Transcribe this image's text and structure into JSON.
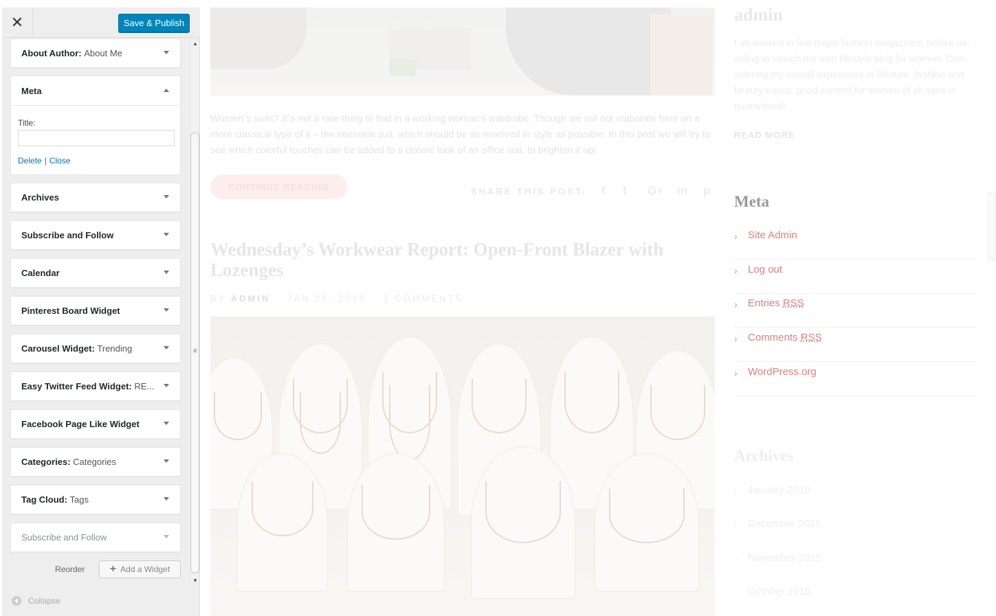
{
  "customizer": {
    "save_label": "Save & Publish",
    "close_glyph": "✕",
    "widgets_top": [
      {
        "title": "About Author",
        "sub": "About Me"
      }
    ],
    "meta_widget": {
      "title": "Meta",
      "title_label": "Title:",
      "title_value": "",
      "delete_label": "Delete",
      "separator": "|",
      "close_label": "Close"
    },
    "widgets": [
      {
        "title": "Archives",
        "sub": ""
      },
      {
        "title": "Subscribe and Follow",
        "sub": ""
      },
      {
        "title": "Calendar",
        "sub": ""
      },
      {
        "title": "Pinterest Board Widget",
        "sub": ""
      },
      {
        "title": "Carousel Widget",
        "sub": "Trending"
      },
      {
        "title": "Easy Twitter Feed Widget",
        "sub": "RE..."
      },
      {
        "title": "Facebook Page Like Widget",
        "sub": ""
      },
      {
        "title": "Categories",
        "sub": "Categories"
      },
      {
        "title": "Tag Cloud",
        "sub": "Tags"
      },
      {
        "title": "Subscribe and Follow",
        "sub": ""
      }
    ],
    "reorder_label": "Reorder",
    "add_widget_label": "Add a Widget",
    "collapse_label": "Collapse"
  },
  "preview": {
    "excerpt": "Women´s suits? It´s not a rare thing to find in a working woman's wardrobe. Though we will not elaborate here on a more classical type of it – the interview suit, which should be as reserved in style as possible. In this post we will try to see which colorful touches can be added to a classic look of an office suit, to brighten it up!",
    "continue_label": "CONTINUE READING",
    "share_label": "SHARE THIS POST:",
    "share_icons": [
      "f",
      "t",
      "G+",
      "in",
      "p"
    ],
    "post_title": "Wednesday’s Workwear Report: Open-Front Blazer with Lozenges",
    "post_meta": {
      "by": "BY",
      "author": "ADMIN",
      "date": "JAN 28, 2016",
      "comments": "3 COMMENTS"
    },
    "about": {
      "name": "admin",
      "text": "I´ve worked in few major fashion magazines, before de- ciding to launch my own lifestyle blog for women. Con- sidering my overall experience in lifestyle, fashion and beauty topics, good content for women of all ages is guaranteed!",
      "read_more": "READ MORE"
    },
    "meta": {
      "heading": "Meta",
      "items": [
        {
          "pre": "Site Admin",
          "abbr": ""
        },
        {
          "pre": "Log out",
          "abbr": ""
        },
        {
          "pre": "Entries ",
          "abbr": "RSS"
        },
        {
          "pre": "Comments ",
          "abbr": "RSS"
        },
        {
          "pre": "WordPress.org",
          "abbr": ""
        }
      ]
    },
    "archives": {
      "heading": "Archives",
      "items": [
        "January 2016",
        "December 2015",
        "November 2015",
        "October 2015"
      ]
    }
  },
  "colors": {
    "accent": "#0085ba",
    "link": "#0073aa",
    "meta_link": "#e07e7e"
  }
}
